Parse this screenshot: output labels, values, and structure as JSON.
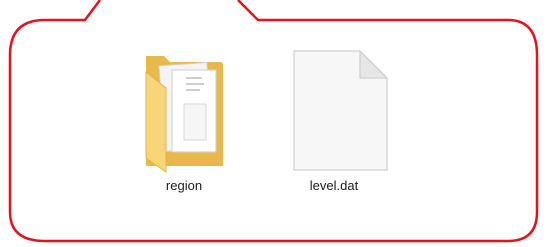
{
  "accent_color": "#e0141e",
  "files": [
    {
      "name": "region",
      "type": "folder",
      "icon": "folder-icon"
    },
    {
      "name": "level.dat",
      "type": "file",
      "icon": "document-icon"
    }
  ]
}
